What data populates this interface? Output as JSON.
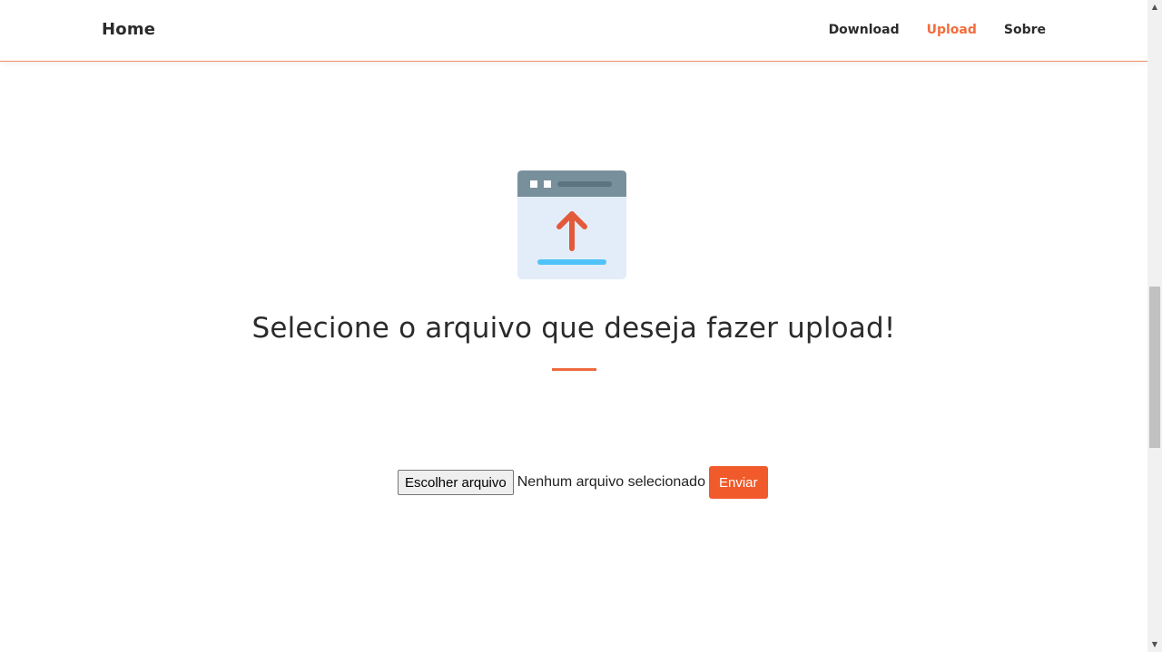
{
  "navbar": {
    "brand": "Home",
    "links": [
      {
        "label": "Download",
        "active": false
      },
      {
        "label": "Upload",
        "active": true
      },
      {
        "label": "Sobre",
        "active": false
      }
    ]
  },
  "main": {
    "illustration_icon": "upload-window-icon",
    "heading": "Selecione o arquivo que deseja fazer upload!",
    "form": {
      "file_button_label": "Escolher arquivo",
      "file_status": "Nenhum arquivo selecionado",
      "submit_label": "Enviar"
    }
  },
  "colors": {
    "accent": "#f26d3d",
    "button": "#f15a2b",
    "window_bar": "#78909c",
    "window_body": "#e3edf9",
    "arrow": "#e35a3b",
    "underline": "#4fc3f7"
  }
}
